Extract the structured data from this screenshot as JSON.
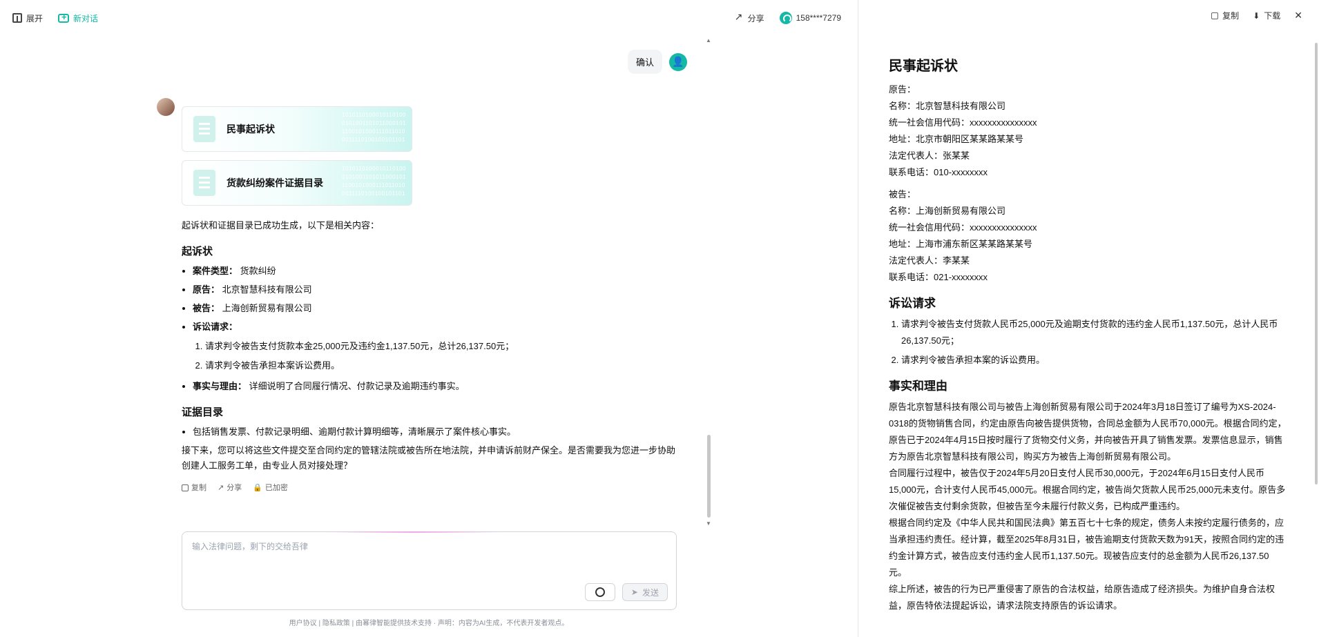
{
  "topbar": {
    "expand": "展开",
    "new_chat": "新对话",
    "share": "分享",
    "user": "158****7279"
  },
  "user_message": "确认",
  "assistant": {
    "cards": [
      {
        "title": "民事起诉状"
      },
      {
        "title": "货款纠纷案件证据目录"
      }
    ],
    "intro": "起诉状和证据目录已成功生成，以下是相关内容：",
    "sections": {
      "complaint_title": "起诉状",
      "items": [
        {
          "label": "案件类型：",
          "value": "货款纠纷"
        },
        {
          "label": "原告：",
          "value": "北京智慧科技有限公司"
        },
        {
          "label": "被告：",
          "value": "上海创新贸易有限公司"
        },
        {
          "label": "诉讼请求：",
          "value": ""
        }
      ],
      "requests": [
        "请求判令被告支付货款本金25,000元及违约金1,137.50元，总计26,137.50元；",
        "请求判令被告承担本案诉讼费用。"
      ],
      "fact_label": "事实与理由：",
      "fact_value": "详细说明了合同履行情况、付款记录及逾期违约事实。",
      "evidence_title": "证据目录",
      "evidence_item": "包括销售发票、付款记录明细、逾期付款计算明细等，清晰展示了案件核心事实。",
      "next_steps": "接下来，您可以将这些文件提交至合同约定的管辖法院或被告所在地法院，并申请诉前财产保全。是否需要我为您进一步协助创建人工服务工单，由专业人员对接处理？"
    },
    "actions": [
      "复制",
      "分享",
      "已加密"
    ]
  },
  "input": {
    "placeholder": "输入法律问题，剩下的交给吾律",
    "send": "发送"
  },
  "footer": "用户协议 | 隐私政策 | 由幂律智能提供技术支持 · 声明：内容为AI生成，不代表开发者观点。",
  "right_pane": {
    "actions": [
      "复制",
      "下载"
    ],
    "doc_title": "民事起诉状",
    "plaintiff": {
      "label": "原告：",
      "name": "名称：北京智慧科技有限公司",
      "code": "统一社会信用代码：xxxxxxxxxxxxxxx",
      "address": "地址：北京市朝阳区某某路某某号",
      "legal_rep": "法定代表人：张某某",
      "phone": "联系电话：010-xxxxxxxx"
    },
    "defendant": {
      "label": "被告：",
      "name": "名称：上海创新贸易有限公司",
      "code": "统一社会信用代码：xxxxxxxxxxxxxxx",
      "address": "地址：上海市浦东新区某某路某某号",
      "legal_rep": "法定代表人：李某某",
      "phone": "联系电话：021-xxxxxxxx"
    },
    "claims_title": "诉讼请求",
    "claims": [
      "请求判令被告支付货款人民币25,000元及逾期支付货款的违约金人民币1,137.50元，总计人民币26,137.50元；",
      "请求判令被告承担本案的诉讼费用。"
    ],
    "facts_title": "事实和理由",
    "facts": [
      "原告北京智慧科技有限公司与被告上海创新贸易有限公司于2024年3月18日签订了编号为XS-2024-0318的货物销售合同，约定由原告向被告提供货物，合同总金额为人民币70,000元。根据合同约定，原告已于2024年4月15日按时履行了货物交付义务，并向被告开具了销售发票。发票信息显示，销售方为原告北京智慧科技有限公司，购买方为被告上海创新贸易有限公司。",
      "合同履行过程中，被告仅于2024年5月20日支付人民币30,000元，于2024年6月15日支付人民币15,000元，合计支付人民币45,000元。根据合同约定，被告尚欠货款人民币25,000元未支付。原告多次催促被告支付剩余货款，但被告至今未履行付款义务，已构成严重违约。",
      "根据合同约定及《中华人民共和国民法典》第五百七十七条的规定，债务人未按约定履行债务的，应当承担违约责任。经计算，截至2025年8月31日，被告逾期支付货款天数为91天，按照合同约定的违约金计算方式，被告应支付违约金人民币1,137.50元。现被告应支付的总金额为人民币26,137.50元。",
      "综上所述，被告的行为已严重侵害了原告的合法权益，给原告造成了经济损失。为维护自身合法权益，原告特依法提起诉讼，请求法院支持原告的诉讼请求。"
    ]
  }
}
